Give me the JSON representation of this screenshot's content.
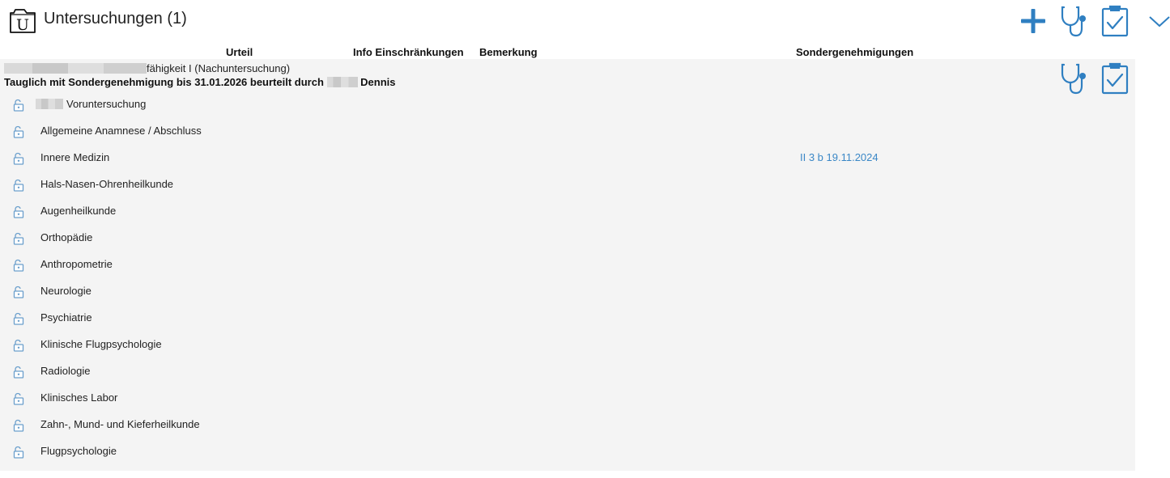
{
  "header": {
    "title": "Untersuchungen (1)",
    "icon_letter": "U"
  },
  "toolbar": {
    "add_icon": "plus-icon",
    "stethoscope_icon": "stethoscope-icon",
    "clipboard_icon": "clipboard-check-icon",
    "collapse_icon": "chevron-down-icon"
  },
  "columns": {
    "urteil": "Urteil",
    "info": "Info Einschränkungen",
    "bemerkung": "Bemerkung",
    "sondergenehmigungen": "Sondergenehmigungen"
  },
  "case": {
    "title_visible": "fähigkeit I (Nachuntersuchung)",
    "verdict_prefix": "Tauglich mit Sondergenehmigung bis 31.01.2026 beurteilt durch",
    "verdict_name": "Dennis"
  },
  "rows": [
    {
      "label": "Voruntersuchung",
      "sondergenehmigung": ""
    },
    {
      "label": "Allgemeine Anamnese / Abschluss",
      "sondergenehmigung": ""
    },
    {
      "label": "Innere Medizin",
      "sondergenehmigung": "II 3 b 19.11.2024"
    },
    {
      "label": "Hals-Nasen-Ohrenheilkunde",
      "sondergenehmigung": ""
    },
    {
      "label": "Augenheilkunde",
      "sondergenehmigung": ""
    },
    {
      "label": "Orthopädie",
      "sondergenehmigung": ""
    },
    {
      "label": "Anthropometrie",
      "sondergenehmigung": ""
    },
    {
      "label": "Neurologie",
      "sondergenehmigung": ""
    },
    {
      "label": "Psychiatrie",
      "sondergenehmigung": ""
    },
    {
      "label": "Klinische Flugpsychologie",
      "sondergenehmigung": ""
    },
    {
      "label": "Radiologie",
      "sondergenehmigung": ""
    },
    {
      "label": "Klinisches Labor",
      "sondergenehmigung": ""
    },
    {
      "label": "Zahn-, Mund- und Kieferheilkunde",
      "sondergenehmigung": ""
    },
    {
      "label": "Flugpsychologie",
      "sondergenehmigung": ""
    }
  ],
  "colors": {
    "accent": "#2f7fc1",
    "link": "#3a87c6",
    "panel_bg": "#f4f4f4"
  }
}
